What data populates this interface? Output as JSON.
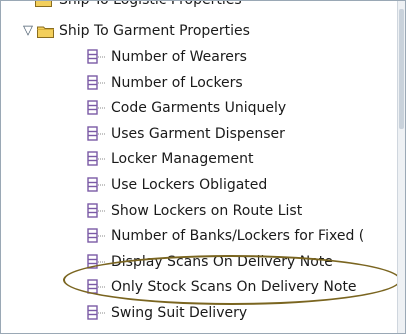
{
  "tree": {
    "clipped_item": {
      "label": "Ship To Logistic Properties"
    },
    "parent": {
      "label": "Ship To Garment Properties",
      "toggle_glyph": "▽",
      "icon": "folder-icon"
    },
    "children": [
      {
        "label": "Number of Wearers",
        "icon": "property-node-icon"
      },
      {
        "label": "Number of Lockers",
        "icon": "property-node-icon"
      },
      {
        "label": "Code Garments Uniquely",
        "icon": "property-node-icon"
      },
      {
        "label": "Uses Garment Dispenser",
        "icon": "property-node-icon"
      },
      {
        "label": "Locker Management",
        "icon": "property-node-icon"
      },
      {
        "label": "Use Lockers Obligated",
        "icon": "property-node-icon"
      },
      {
        "label": "Show Lockers on Route List",
        "icon": "property-node-icon"
      },
      {
        "label": "Number of Banks/Lockers for Fixed (",
        "icon": "property-node-icon"
      },
      {
        "label": "Display Scans On Delivery Note",
        "icon": "property-node-icon"
      },
      {
        "label": "Only Stock Scans On Delivery Note",
        "icon": "property-node-icon"
      },
      {
        "label": "Swing Suit Delivery",
        "icon": "property-node-icon"
      }
    ]
  },
  "colors": {
    "folder": "#f3cf5c",
    "node_icon": "#7b5aa6",
    "highlight": "#7a6520"
  }
}
